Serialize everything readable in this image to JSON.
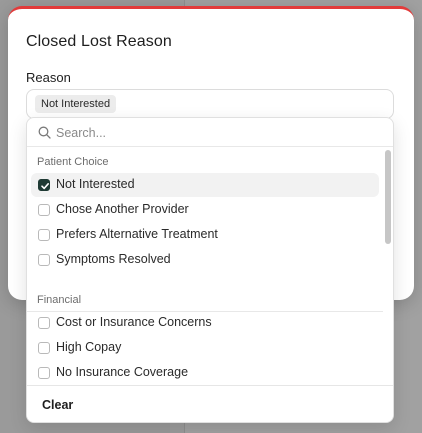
{
  "modal": {
    "title": "Closed Lost Reason",
    "field_label": "Reason",
    "selected_chip": "Not Interested",
    "accent_color": "#e23b3b"
  },
  "dropdown": {
    "search_placeholder": "Search...",
    "search_value": "",
    "groups": [
      {
        "heading": "Patient Choice",
        "options": [
          {
            "label": "Not Interested",
            "checked": true
          },
          {
            "label": "Chose Another Provider",
            "checked": false
          },
          {
            "label": "Prefers Alternative Treatment",
            "checked": false
          },
          {
            "label": "Symptoms Resolved",
            "checked": false
          }
        ]
      },
      {
        "heading": "Financial",
        "options": [
          {
            "label": "Cost or Insurance Concerns",
            "checked": false
          },
          {
            "label": "High Copay",
            "checked": false
          },
          {
            "label": "No Insurance Coverage",
            "checked": false
          }
        ]
      }
    ],
    "clear_label": "Clear",
    "check_color": "#1f3a34"
  }
}
